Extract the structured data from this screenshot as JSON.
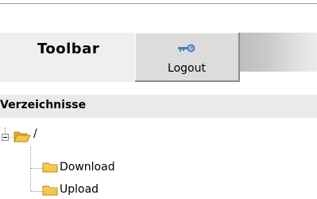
{
  "toolbar": {
    "title": "Toolbar",
    "logout_label": "Logout",
    "logout_icon": "key-icon"
  },
  "directories": {
    "header": "Verzeichnisse",
    "root": {
      "label": "/",
      "expanded": true,
      "icon": "folder-open-icon",
      "children": [
        {
          "label": "Download",
          "icon": "folder-icon"
        },
        {
          "label": "Upload",
          "icon": "folder-icon"
        }
      ]
    }
  },
  "colors": {
    "folder_fill": "#f5c842",
    "folder_outline": "#b08a1e",
    "key_color": "#4a7fb8"
  }
}
